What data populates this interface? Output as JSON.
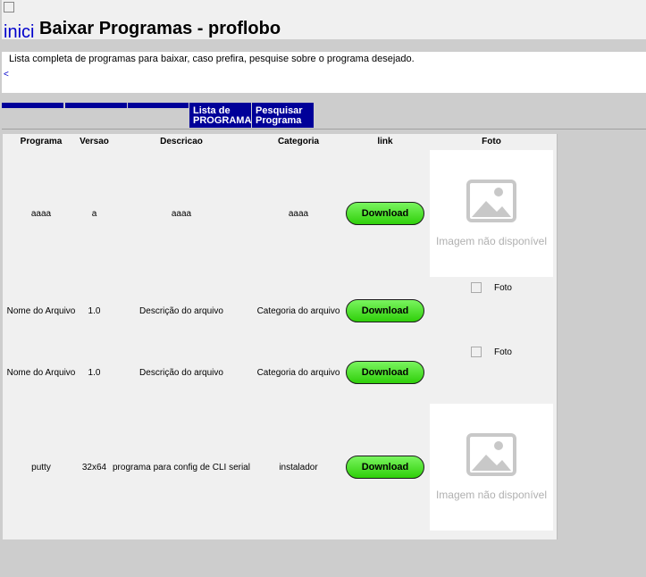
{
  "header": {
    "logo_alt": "inici",
    "title": "Baixar Programas - proflobo"
  },
  "description": {
    "text": "Lista completa de programas para baixar, caso prefira, pesquise sobre o programa desejado.",
    "back": "<"
  },
  "nav": {
    "items": [
      "",
      "",
      "",
      "Lista de PROGRAMAS",
      "Pesquisar Programa"
    ]
  },
  "table": {
    "headers": [
      "Programa",
      "Versao",
      "Descricao",
      "Categoria",
      "link",
      "Foto"
    ],
    "rows": [
      {
        "programa": "aaaa",
        "versao": "a",
        "descricao": "aaaa",
        "categoria": "aaaa",
        "link": "Download",
        "foto": "placeholder"
      },
      {
        "programa": "Nome do Arquivo",
        "versao": "1.0",
        "descricao": "Descrição do arquivo",
        "categoria": "Categoria do arquivo",
        "link": "Download",
        "foto": "Foto"
      },
      {
        "programa": "Nome do Arquivo",
        "versao": "1.0",
        "descricao": "Descrição do arquivo",
        "categoria": "Categoria do arquivo",
        "link": "Download",
        "foto": "Foto"
      },
      {
        "programa": "putty",
        "versao": "32x64",
        "descricao": "programa para config de CLI serial",
        "categoria": "instalador",
        "link": "Download",
        "foto": "placeholder"
      }
    ],
    "placeholder_text": "Imagem não disponível"
  },
  "colors": {
    "nav_bg": "#000099",
    "download_green": "#2fcf0a",
    "page_bg": "#cdcdcd"
  }
}
